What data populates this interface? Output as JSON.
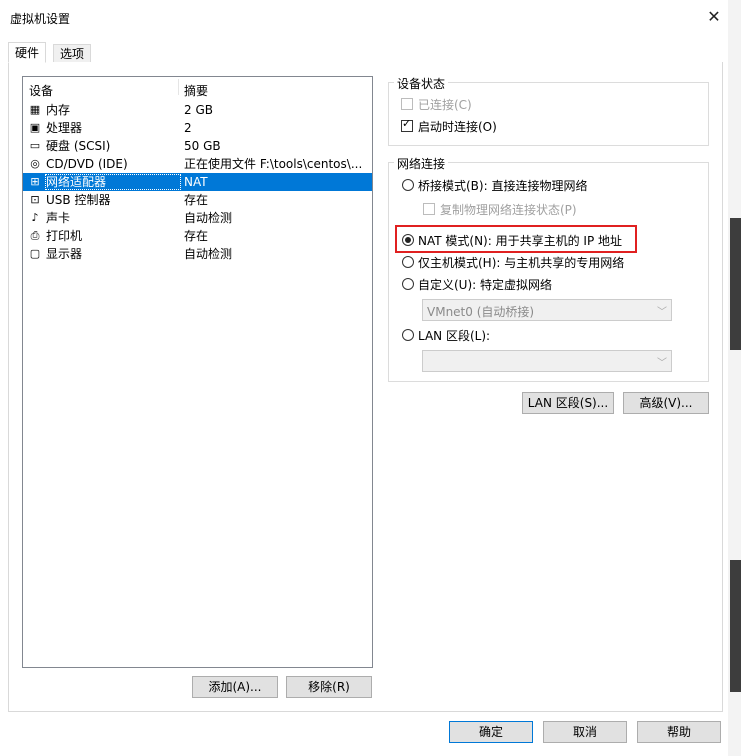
{
  "window": {
    "title": "虚拟机设置"
  },
  "tabs": [
    {
      "label": "硬件"
    },
    {
      "label": "选项"
    }
  ],
  "device_list": {
    "headers": [
      "设备",
      "摘要"
    ],
    "rows": [
      {
        "name": "内存",
        "summary": "2 GB",
        "icon": "memory-icon"
      },
      {
        "name": "处理器",
        "summary": "2",
        "icon": "cpu-icon"
      },
      {
        "name": "硬盘 (SCSI)",
        "summary": "50 GB",
        "icon": "harddisk-icon"
      },
      {
        "name": "CD/DVD (IDE)",
        "summary": "正在使用文件 F:\\tools\\centos\\...",
        "icon": "cd-dvd-icon"
      },
      {
        "name": "网络适配器",
        "summary": "NAT",
        "icon": "network-adapter-icon",
        "selected": true
      },
      {
        "name": "USB 控制器",
        "summary": "存在",
        "icon": "usb-icon"
      },
      {
        "name": "声卡",
        "summary": "自动检测",
        "icon": "speaker-icon"
      },
      {
        "name": "打印机",
        "summary": "存在",
        "icon": "printer-icon"
      },
      {
        "name": "显示器",
        "summary": "自动检测",
        "icon": "monitor-icon"
      }
    ]
  },
  "left_buttons": {
    "add": "添加(A)...",
    "remove": "移除(R)"
  },
  "device_status": {
    "group_label": "设备状态",
    "connected": {
      "label": "已连接(C)",
      "checked": false,
      "disabled": true
    },
    "connect_on_start": {
      "label": "启动时连接(O)",
      "checked": true
    }
  },
  "network": {
    "group_label": "网络连接",
    "bridged": "桥接模式(B): 直接连接物理网络",
    "replicate": "复制物理网络连接状态(P)",
    "nat": "NAT 模式(N): 用于共享主机的 IP 地址",
    "hostonly": "仅主机模式(H): 与主机共享的专用网络",
    "custom": "自定义(U): 特定虚拟网络",
    "custom_select": "VMnet0 (自动桥接)",
    "lan": "LAN 区段(L):",
    "lan_select": "",
    "selected": "nat"
  },
  "right_buttons": {
    "lan_segment": "LAN 区段(S)...",
    "advanced": "高级(V)..."
  },
  "footer_buttons": {
    "ok": "确定",
    "cancel": "取消",
    "help": "帮助"
  },
  "colors": {
    "selection": "#0078d7",
    "highlight_box": "#e02020"
  }
}
